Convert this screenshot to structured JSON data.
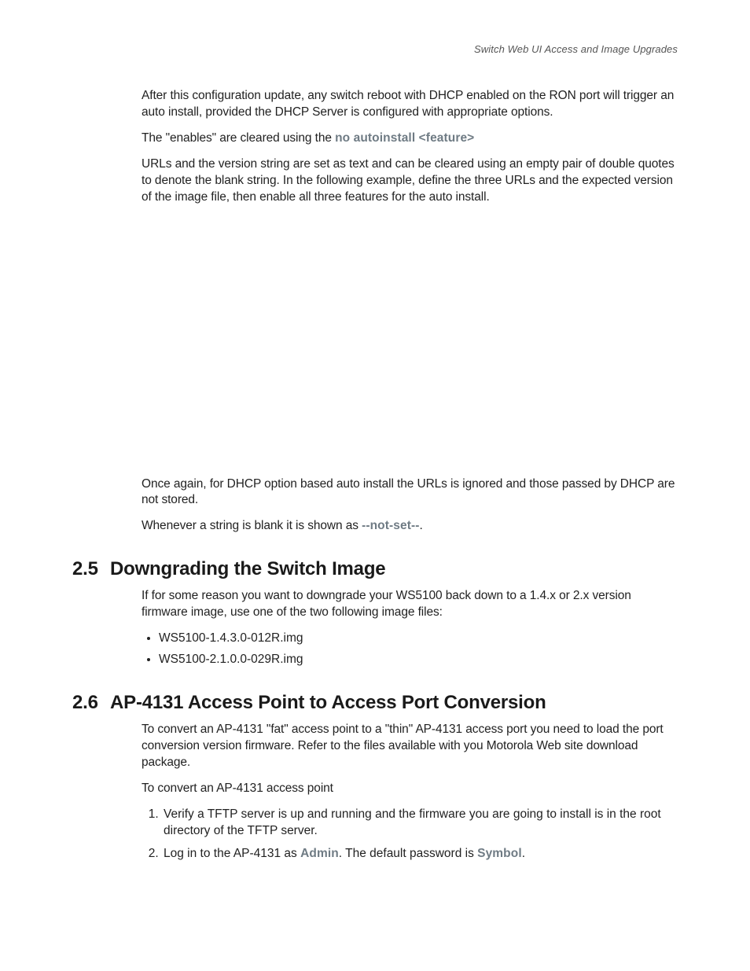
{
  "header": {
    "running_title": "Switch Web UI Access and Image Upgrades"
  },
  "intro": {
    "p1": "After this configuration update, any switch reboot with DHCP enabled on the RON port will trigger an auto install, provided the DHCP Server is configured with appropriate options.",
    "p2_pre": "The \"enables\" are cleared using the ",
    "p2_hl": "no autoinstall <feature>",
    "p3": "URLs and the version string are set as text and can be cleared using an empty pair of double quotes to denote the blank string. In the following example, define the three URLs and the expected version of the image file, then enable all three features for the auto install."
  },
  "after_block": {
    "p4": "Once again, for DHCP option based auto install the URLs is ignored and those passed by DHCP are not stored.",
    "p5_pre": "Whenever a string is blank it is shown as ",
    "p5_hl": "--not-set--",
    "p5_post": "."
  },
  "section_2_5": {
    "num": "2.5",
    "title": "Downgrading the Switch Image",
    "p1": "If for some reason you want to downgrade your WS5100 back down to a 1.4.x or 2.x version firmware image, use one of the two following image files:",
    "bullets": [
      "WS5100-1.4.3.0-012R.img",
      "WS5100-2.1.0.0-029R.img"
    ]
  },
  "section_2_6": {
    "num": "2.6",
    "title": "AP-4131 Access Point to Access Port Conversion",
    "p1": "To convert an AP-4131 \"fat\" access point to a \"thin\" AP-4131 access port you need to load the port conversion version firmware. Refer to the files available with you Motorola Web site download package.",
    "p2": "To convert an AP-4131 access point",
    "steps": {
      "s1": "Verify a TFTP server is up and running and the firmware you are going to install is in the root directory of the TFTP server.",
      "s2_pre": "Log in to the AP-4131 as ",
      "s2_hl1": "Admin",
      "s2_mid": ". The default password is ",
      "s2_hl2": "Symbol",
      "s2_post": "."
    }
  }
}
